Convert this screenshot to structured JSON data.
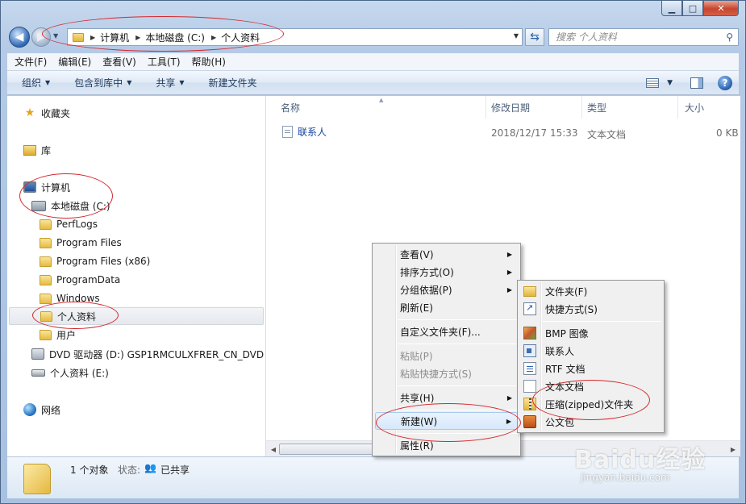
{
  "window": {
    "caption": {
      "minimize": "▁",
      "maximize": "□",
      "close": "✕"
    }
  },
  "address": {
    "crumbs": [
      "计算机",
      "本地磁盘 (C:)",
      "个人资料"
    ]
  },
  "search": {
    "placeholder": "搜索 个人资料"
  },
  "menubar": [
    "文件(F)",
    "编辑(E)",
    "查看(V)",
    "工具(T)",
    "帮助(H)"
  ],
  "toolbar": {
    "organize": "组织",
    "include_library": "包含到库中",
    "share": "共享",
    "new_folder": "新建文件夹"
  },
  "navpane": {
    "favorites": "收藏夹",
    "libraries": "库",
    "computer": "计算机",
    "local_disk": "本地磁盘 (C:)",
    "folders": [
      "PerfLogs",
      "Program Files",
      "Program Files (x86)",
      "ProgramData",
      "Windows",
      "个人资料",
      "用户"
    ],
    "dvd": "DVD 驱动器 (D:) GSP1RMCULXFRER_CN_DVD",
    "drive_e": "个人资料 (E:)",
    "network": "网络"
  },
  "filelist": {
    "columns": [
      "名称",
      "修改日期",
      "类型",
      "大小"
    ],
    "rows": [
      {
        "name": "联系人",
        "date": "2018/12/17 15:33",
        "type": "文本文档",
        "size": "0 KB"
      }
    ]
  },
  "details": {
    "count": "1 个对象",
    "state_label": "状态:",
    "state": "已共享"
  },
  "context_menu": {
    "items": [
      "查看(V)",
      "排序方式(O)",
      "分组依据(P)",
      "刷新(E)",
      "自定义文件夹(F)...",
      "粘贴(P)",
      "粘贴快捷方式(S)",
      "共享(H)",
      "新建(W)",
      "属性(R)"
    ]
  },
  "submenu": {
    "items": [
      "文件夹(F)",
      "快捷方式(S)",
      "BMP 图像",
      "联系人",
      "RTF 文档",
      "文本文档",
      "压缩(zipped)文件夹",
      "公文包"
    ]
  },
  "watermark": {
    "main": "Baidu经验",
    "sub": "jingyan.baidu.com"
  },
  "colors": {
    "annotation": "#d4282d",
    "link": "#1643a3"
  }
}
